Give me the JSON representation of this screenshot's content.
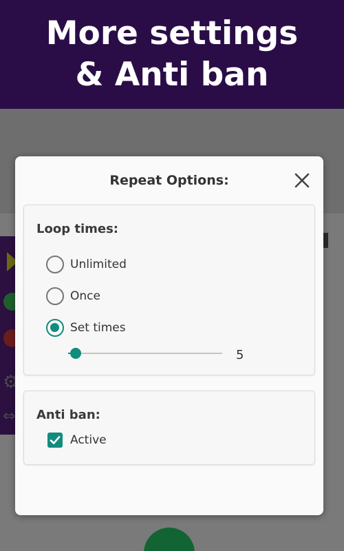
{
  "banner": {
    "line1": "More settings",
    "line2": "& Anti ban"
  },
  "dialog": {
    "title": "Repeat Options:",
    "close_icon": "close-icon"
  },
  "loop": {
    "title": "Loop times:",
    "options": [
      {
        "label": "Unlimited",
        "checked": false
      },
      {
        "label": "Once",
        "checked": false
      },
      {
        "label": "Set times",
        "checked": true
      }
    ],
    "slider_fraction": 0.05,
    "value": "5"
  },
  "anti_ban": {
    "title": "Anti ban:",
    "checkbox_label": "Active",
    "checked": true
  },
  "colors": {
    "banner_bg": "#2a0d47",
    "accent": "#128c7e"
  }
}
